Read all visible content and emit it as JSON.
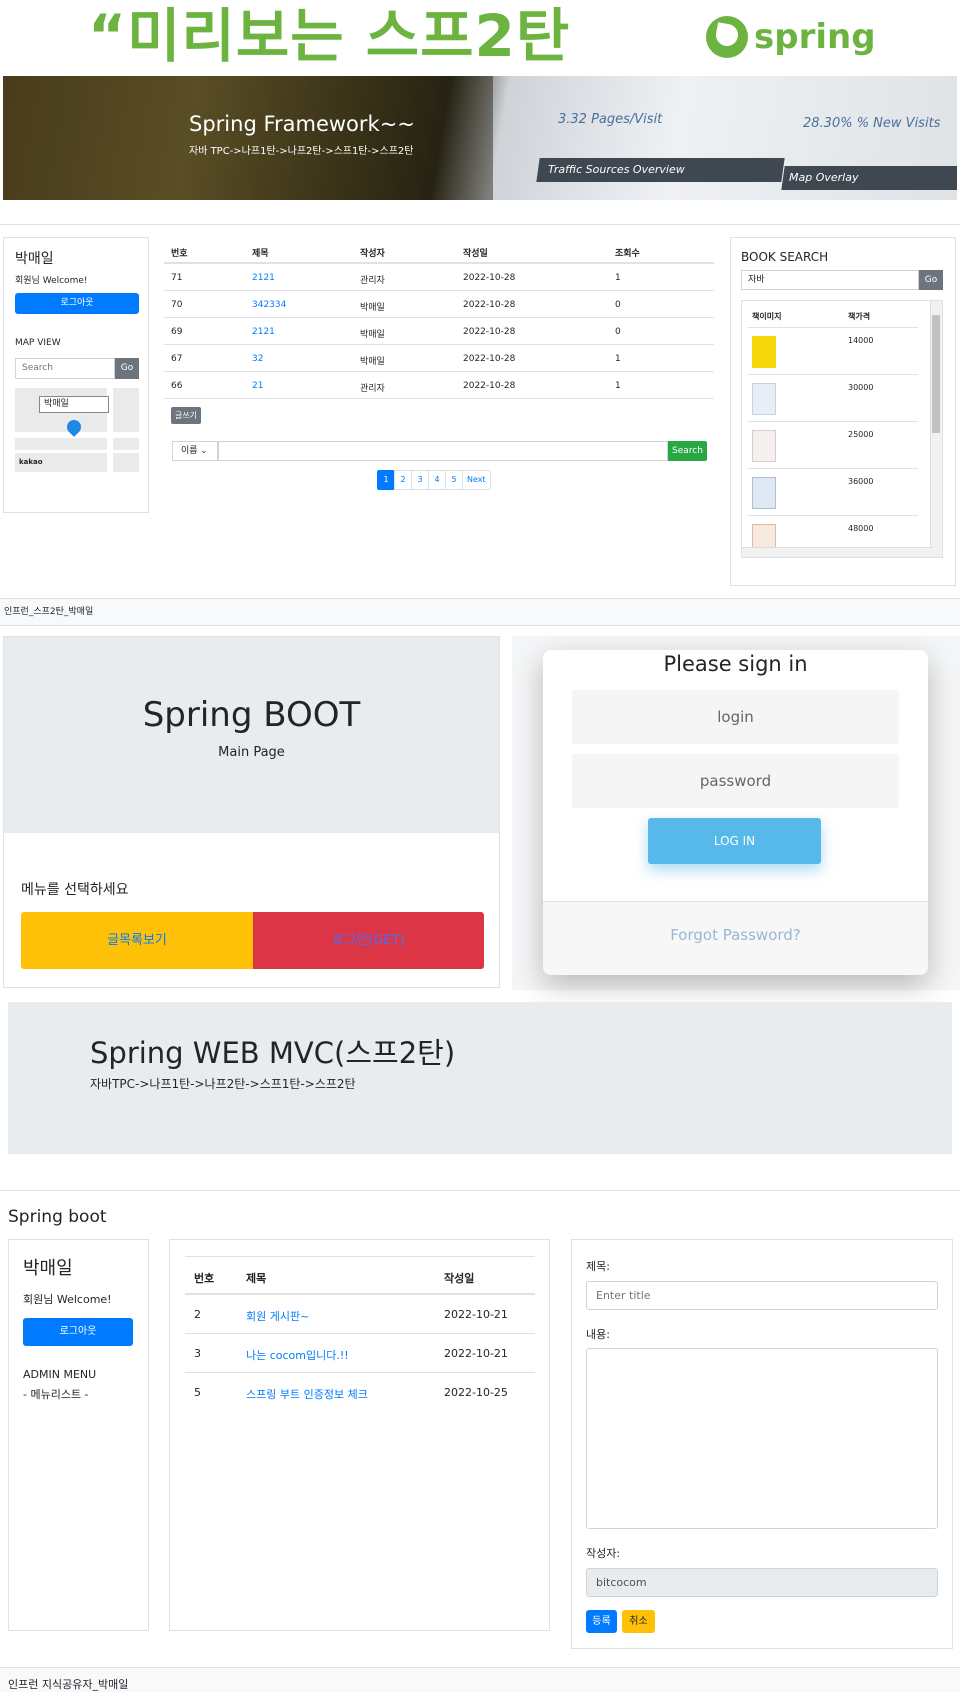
{
  "header": {
    "title": "“미리보는 스프2탄",
    "logo_text": "spring"
  },
  "banner": {
    "title": "Spring Framework~~",
    "subtitle": "자바 TPC->나프1탄->나프2탄->스프1탄->스프2탄",
    "metric1": "3.32 Pages/Visit",
    "metric2": "28.30% % New Visits",
    "tab1": "Traffic Sources Overview",
    "tab2": "Map Overlay"
  },
  "user_panel": {
    "username": "박매일",
    "welcome": "회원님 Welcome!",
    "logout_label": "로그아웃",
    "map_view_label": "MAP VIEW",
    "map_search_placeholder": "Search",
    "map_go_label": "Go",
    "map_marker_label": "박매일",
    "map_brand": "kakao"
  },
  "board": {
    "headers": [
      "번호",
      "제목",
      "작성자",
      "작성일",
      "조회수"
    ],
    "rows": [
      {
        "no": "71",
        "title": "2121",
        "author": "관리자",
        "date": "2022-10-28",
        "views": "1"
      },
      {
        "no": "70",
        "title": "342334",
        "author": "박매일",
        "date": "2022-10-28",
        "views": "0"
      },
      {
        "no": "69",
        "title": "2121",
        "author": "박매일",
        "date": "2022-10-28",
        "views": "0"
      },
      {
        "no": "67",
        "title": "32",
        "author": "박매일",
        "date": "2022-10-28",
        "views": "1"
      },
      {
        "no": "66",
        "title": "21",
        "author": "관리자",
        "date": "2022-10-28",
        "views": "1"
      }
    ],
    "write_label": "글쓰기",
    "filter_selected": "이름",
    "search_label": "Search",
    "pages": [
      "1",
      "2",
      "3",
      "4",
      "5"
    ],
    "next_label": "Next"
  },
  "book_search": {
    "title": "BOOK SEARCH",
    "query": "자바",
    "go_label": "Go",
    "headers": [
      "책이미지",
      "책가격"
    ],
    "prices": [
      "14000",
      "30000",
      "25000",
      "36000",
      "48000"
    ],
    "cover_colors": [
      "#f5d90a",
      "#e8eef5",
      "#f4f0f0",
      "#dfe8f3",
      "#f5e9e0"
    ]
  },
  "footer1": "인프런_스프2탄_박매일",
  "boot_main": {
    "title": "Spring BOOT",
    "subtitle": "Main Page",
    "menu_label": "메뉴를 선택하세요",
    "board_button": "글목록보기",
    "login_get_button": "로그인(GET)"
  },
  "signin": {
    "title": "Please sign in",
    "login_placeholder": "login",
    "password_placeholder": "password",
    "button": "LOG IN",
    "forgot": "Forgot Password?"
  },
  "mvc": {
    "title": "Spring WEB MVC(스프2탄)",
    "subtitle": "자바TPC->나프1탄->나프2탄->스프1탄->스프2탄"
  },
  "boot_board": {
    "section_title": "Spring boot",
    "username": "박매일",
    "welcome": "회원님 Welcome!",
    "logout_label": "로그아웃",
    "admin_menu": "ADMIN MENU",
    "menu_list": "- 메뉴리스트 -",
    "headers": [
      "번호",
      "제목",
      "작성일"
    ],
    "rows": [
      {
        "no": "2",
        "title": "회원 게시판~",
        "date": "2022-10-21"
      },
      {
        "no": "3",
        "title": "나는 cocom입니다.!!",
        "date": "2022-10-21"
      },
      {
        "no": "5",
        "title": "스프링 부트 인증정보 체크",
        "date": "2022-10-25"
      }
    ],
    "form": {
      "title_label": "제목:",
      "title_placeholder": "Enter title",
      "content_label": "내용:",
      "author_label": "작성자:",
      "author_value": "bitcocom",
      "register_label": "등록",
      "cancel_label": "취소"
    }
  },
  "footer3": "인프런 지식공유자_박매일"
}
